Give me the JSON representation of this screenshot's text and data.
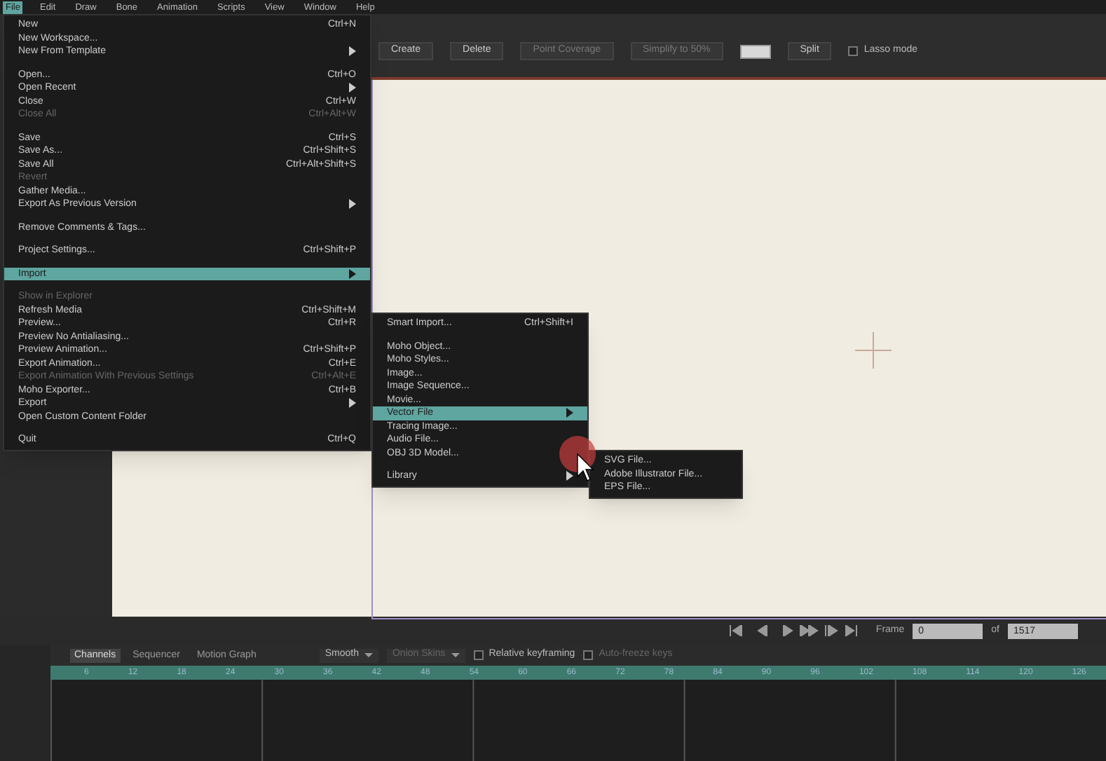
{
  "menubar": [
    {
      "label": "File",
      "selected": true
    },
    {
      "label": "Edit",
      "selected": false
    },
    {
      "label": "Draw",
      "selected": false
    },
    {
      "label": "Bone",
      "selected": false
    },
    {
      "label": "Animation",
      "selected": false
    },
    {
      "label": "Scripts",
      "selected": false
    },
    {
      "label": "View",
      "selected": false
    },
    {
      "label": "Window",
      "selected": false
    },
    {
      "label": "Help",
      "selected": false
    }
  ],
  "toolbar": [
    {
      "kind": "button",
      "label": "Create"
    },
    {
      "kind": "button",
      "label": "Delete"
    },
    {
      "kind": "button",
      "label": "Point Coverage",
      "disabled": true
    },
    {
      "kind": "button",
      "label": "Simplify to 50%",
      "disabled": true
    },
    {
      "kind": "swatch"
    },
    {
      "kind": "button",
      "label": "Split"
    },
    {
      "kind": "check",
      "label": "Lasso mode",
      "checked": false
    }
  ],
  "file_menu": [
    {
      "kind": "item",
      "label": "New",
      "shortcut": "Ctrl+N",
      "disabled": false
    },
    {
      "kind": "item",
      "label": "New Workspace...",
      "disabled": false
    },
    {
      "kind": "submenu",
      "label": "New From Template",
      "disabled": false,
      "selected": false
    },
    {
      "kind": "separator"
    },
    {
      "kind": "item",
      "label": "Open...",
      "shortcut": "Ctrl+O",
      "disabled": false
    },
    {
      "kind": "submenu",
      "label": "Open Recent",
      "disabled": false,
      "selected": false
    },
    {
      "kind": "item",
      "label": "Close",
      "shortcut": "Ctrl+W",
      "disabled": false
    },
    {
      "kind": "item",
      "label": "Close All",
      "shortcut": "Ctrl+Alt+W",
      "disabled": true
    },
    {
      "kind": "separator"
    },
    {
      "kind": "item",
      "label": "Save",
      "shortcut": "Ctrl+S",
      "disabled": false
    },
    {
      "kind": "item",
      "label": "Save As...",
      "shortcut": "Ctrl+Shift+S",
      "disabled": false
    },
    {
      "kind": "item",
      "label": "Save All",
      "shortcut": "Ctrl+Alt+Shift+S",
      "disabled": false
    },
    {
      "kind": "item",
      "label": "Revert",
      "disabled": true
    },
    {
      "kind": "item",
      "label": "Gather Media...",
      "disabled": false
    },
    {
      "kind": "submenu",
      "label": "Export As Previous Version",
      "disabled": false,
      "selected": false
    },
    {
      "kind": "separator"
    },
    {
      "kind": "item",
      "label": "Remove Comments & Tags...",
      "disabled": false
    },
    {
      "kind": "separator"
    },
    {
      "kind": "item",
      "label": "Project Settings...",
      "shortcut": "Ctrl+Shift+P",
      "disabled": false
    },
    {
      "kind": "separator"
    },
    {
      "kind": "submenu",
      "label": "Import",
      "disabled": false,
      "selected": true
    },
    {
      "kind": "separator"
    },
    {
      "kind": "item",
      "label": "Show in Explorer",
      "disabled": true
    },
    {
      "kind": "item",
      "label": "Refresh Media",
      "shortcut": "Ctrl+Shift+M",
      "disabled": false
    },
    {
      "kind": "item",
      "label": "Preview...",
      "shortcut": "Ctrl+R",
      "disabled": false
    },
    {
      "kind": "item",
      "label": "Preview No Antialiasing...",
      "disabled": false
    },
    {
      "kind": "item",
      "label": "Preview Animation...",
      "shortcut": "Ctrl+Shift+P",
      "disabled": false
    },
    {
      "kind": "item",
      "label": "Export Animation...",
      "shortcut": "Ctrl+E",
      "disabled": false
    },
    {
      "kind": "item",
      "label": "Export Animation With Previous Settings",
      "shortcut": "Ctrl+Alt+E",
      "disabled": true
    },
    {
      "kind": "item",
      "label": "Moho Exporter...",
      "shortcut": "Ctrl+B",
      "disabled": false
    },
    {
      "kind": "submenu",
      "label": "Export",
      "disabled": false,
      "selected": false
    },
    {
      "kind": "item",
      "label": "Open Custom Content Folder",
      "disabled": false
    },
    {
      "kind": "separator"
    },
    {
      "kind": "item",
      "label": "Quit",
      "shortcut": "Ctrl+Q",
      "disabled": false
    }
  ],
  "import_menu": [
    {
      "kind": "item",
      "label": "Smart Import...",
      "shortcut": "Ctrl+Shift+I",
      "disabled": false
    },
    {
      "kind": "separator"
    },
    {
      "kind": "item",
      "label": "Moho Object...",
      "disabled": false
    },
    {
      "kind": "item",
      "label": "Moho Styles...",
      "disabled": false
    },
    {
      "kind": "item",
      "label": "Image...",
      "disabled": false
    },
    {
      "kind": "item",
      "label": "Image Sequence...",
      "disabled": false
    },
    {
      "kind": "item",
      "label": "Movie...",
      "disabled": false
    },
    {
      "kind": "submenu",
      "label": "Vector File",
      "disabled": false,
      "selected": true
    },
    {
      "kind": "item",
      "label": "Tracing Image...",
      "disabled": false
    },
    {
      "kind": "item",
      "label": "Audio File...",
      "disabled": false
    },
    {
      "kind": "item",
      "label": "OBJ 3D Model...",
      "disabled": false
    },
    {
      "kind": "separator"
    },
    {
      "kind": "submenu",
      "label": "Library",
      "disabled": false,
      "selected": false
    }
  ],
  "vector_menu": [
    {
      "kind": "item",
      "label": "SVG File...",
      "disabled": false
    },
    {
      "kind": "item",
      "label": "Adobe Illustrator File...",
      "disabled": false
    },
    {
      "kind": "item",
      "label": "EPS File...",
      "disabled": false
    }
  ],
  "playback": {
    "frame_label": "Frame",
    "frame": "0",
    "of_label": "of",
    "total": "1517"
  },
  "timeline_tabs": [
    {
      "label": "Channels",
      "selected": true
    },
    {
      "label": "Sequencer",
      "selected": false
    },
    {
      "label": "Motion Graph",
      "selected": false
    }
  ],
  "timeline_controls": [
    {
      "kind": "dropdown",
      "label": "Smooth"
    },
    {
      "kind": "dropdown",
      "label": "Onion Skins",
      "disabled": true
    },
    {
      "kind": "check",
      "label": "Relative keyframing",
      "checked": false
    },
    {
      "kind": "check",
      "label": "Auto-freeze keys",
      "checked": false,
      "disabled": true
    }
  ],
  "ruler": [
    "6",
    "12",
    "18",
    "24",
    "30",
    "36",
    "42",
    "48",
    "54",
    "60",
    "66",
    "72",
    "78",
    "84",
    "90",
    "96",
    "102",
    "108",
    "114",
    "120",
    "126"
  ]
}
